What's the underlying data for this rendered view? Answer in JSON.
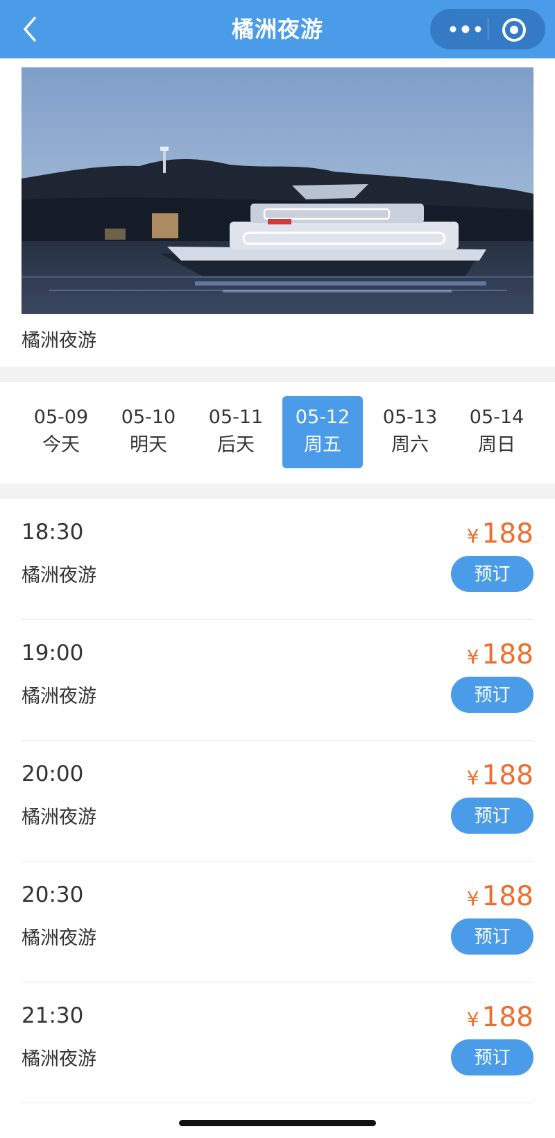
{
  "header": {
    "title": "橘洲夜游",
    "accent": "#4a9be8"
  },
  "banner": {
    "caption": "橘洲夜游"
  },
  "dates": [
    {
      "date": "05-09",
      "label": "今天",
      "active": false
    },
    {
      "date": "05-10",
      "label": "明天",
      "active": false
    },
    {
      "date": "05-11",
      "label": "后天",
      "active": false
    },
    {
      "date": "05-12",
      "label": "周五",
      "active": true
    },
    {
      "date": "05-13",
      "label": "周六",
      "active": false
    },
    {
      "date": "05-14",
      "label": "周日",
      "active": false
    }
  ],
  "sessions": [
    {
      "time": "18:30",
      "name": "橘洲夜游",
      "currency": "¥",
      "price": "188",
      "button": "预订"
    },
    {
      "time": "19:00",
      "name": "橘洲夜游",
      "currency": "¥",
      "price": "188",
      "button": "预订"
    },
    {
      "time": "20:00",
      "name": "橘洲夜游",
      "currency": "¥",
      "price": "188",
      "button": "预订"
    },
    {
      "time": "20:30",
      "name": "橘洲夜游",
      "currency": "¥",
      "price": "188",
      "button": "预订"
    },
    {
      "time": "21:30",
      "name": "橘洲夜游",
      "currency": "¥",
      "price": "188",
      "button": "预订"
    }
  ],
  "colors": {
    "price": "#ee6c2c",
    "button": "#4a9be8"
  },
  "icons": {
    "back": "chevron-left-icon",
    "more": "more-dots-icon",
    "close": "target-circle-icon"
  }
}
